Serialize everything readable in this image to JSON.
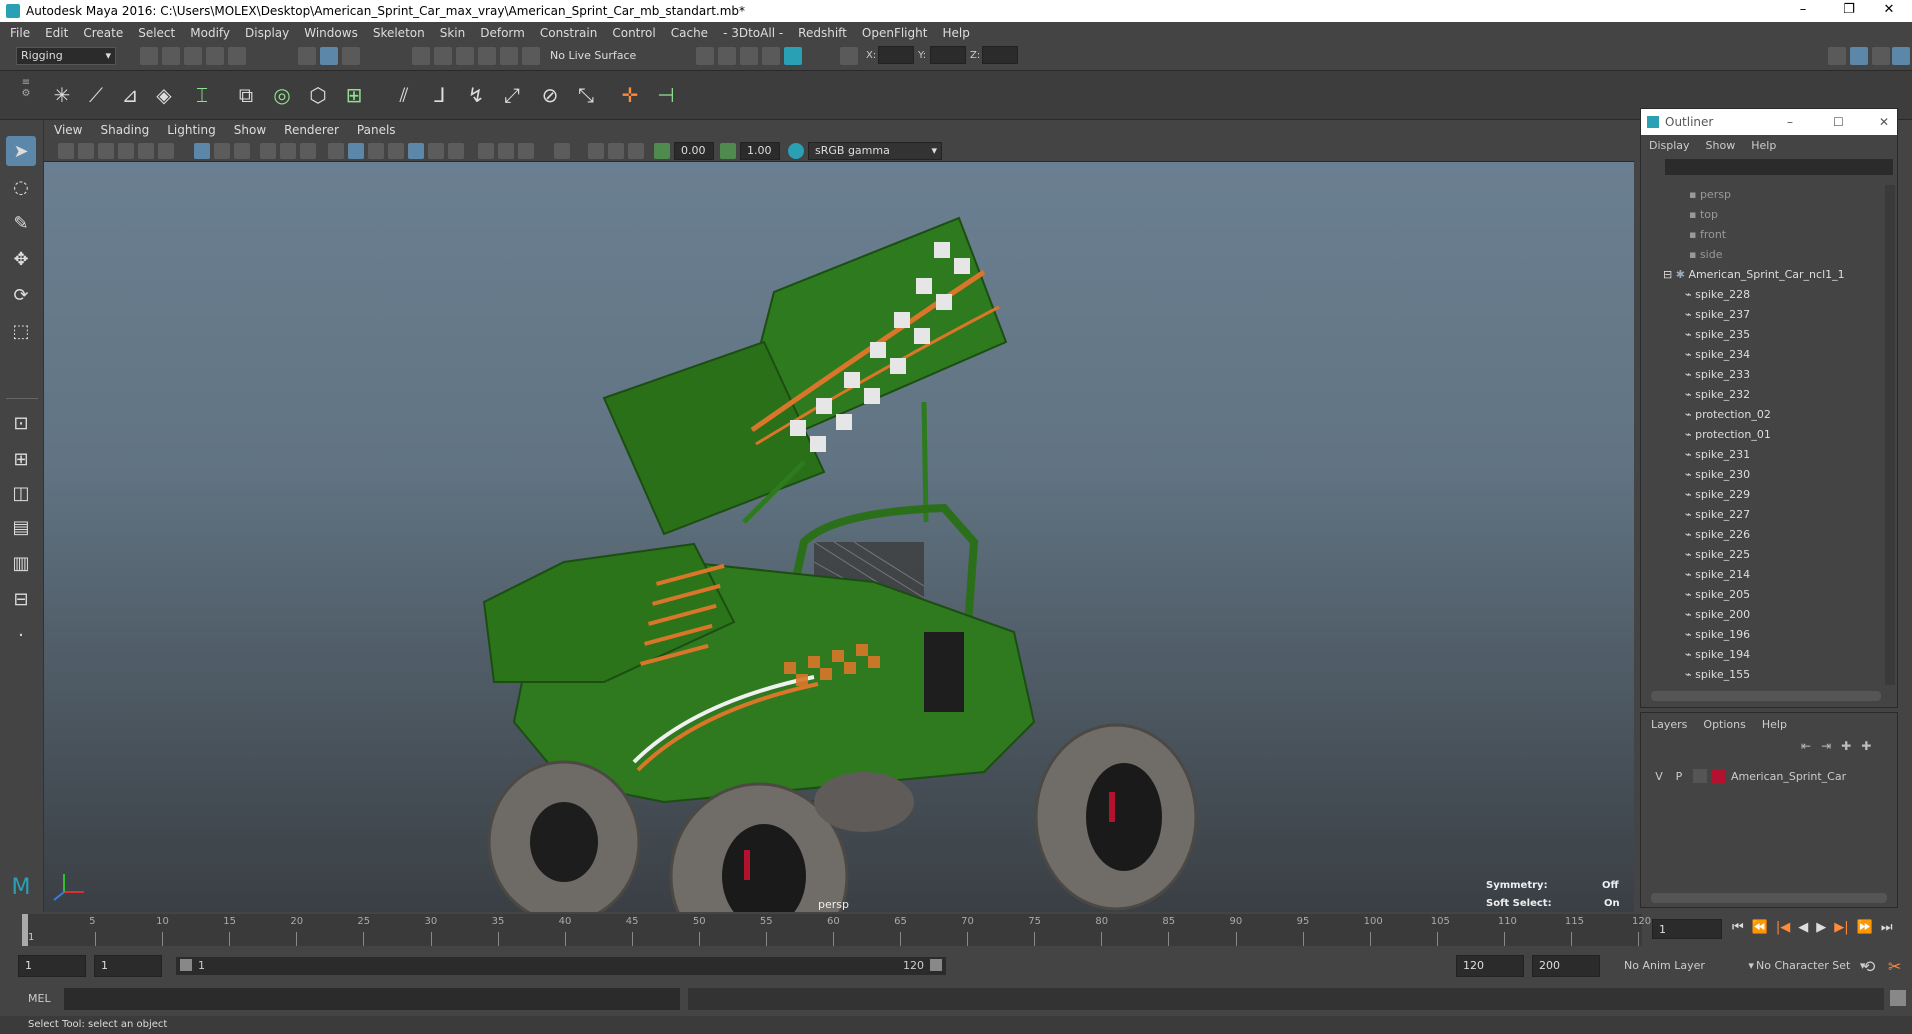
{
  "window": {
    "title": "Autodesk Maya 2016: C:\\Users\\MOLEX\\Desktop\\American_Sprint_Car_max_vray\\American_Sprint_Car_mb_standart.mb*",
    "minimize": "–",
    "restore": "❐",
    "close": "✕"
  },
  "menubar": [
    "File",
    "Edit",
    "Create",
    "Select",
    "Modify",
    "Display",
    "Windows",
    "Skeleton",
    "Skin",
    "Deform",
    "Constrain",
    "Control",
    "Cache",
    "- 3DtoAll -",
    "Redshift",
    "OpenFlight",
    "Help"
  ],
  "statusline": {
    "menuset": "Rigging",
    "live_surface": "No Live Surface",
    "x_label": "X:",
    "y_label": "Y:",
    "z_label": "Z:"
  },
  "viewport": {
    "menus": [
      "View",
      "Shading",
      "Lighting",
      "Show",
      "Renderer",
      "Panels"
    ],
    "near_value": "0.00",
    "far_value": "1.00",
    "color_space": "sRGB gamma",
    "camera_label": "persp",
    "symmetry_label": "Symmetry:",
    "symmetry_value": "Off",
    "soft_select_label": "Soft Select:",
    "soft_select_value": "On"
  },
  "outliner": {
    "title": "Outliner",
    "menus": [
      "Display",
      "Show",
      "Help"
    ],
    "cameras": [
      "persp",
      "top",
      "front",
      "side"
    ],
    "group": "American_Sprint_Car_ncl1_1",
    "items": [
      "spike_228",
      "spike_237",
      "spike_235",
      "spike_234",
      "spike_233",
      "spike_232",
      "protection_02",
      "protection_01",
      "spike_231",
      "spike_230",
      "spike_229",
      "spike_227",
      "spike_226",
      "spike_225",
      "spike_214",
      "spike_205",
      "spike_200",
      "spike_196",
      "spike_194",
      "spike_155"
    ]
  },
  "layers": {
    "menus": [
      "Layers",
      "Options",
      "Help"
    ],
    "layer_v": "V",
    "layer_p": "P",
    "layer_name": "American_Sprint_Car",
    "layer_color": "#b3122e"
  },
  "timeline": {
    "ticks": [
      "5",
      "10",
      "15",
      "20",
      "25",
      "30",
      "35",
      "40",
      "45",
      "50",
      "55",
      "60",
      "65",
      "70",
      "75",
      "80",
      "85",
      "90",
      "95",
      "100",
      "105",
      "110",
      "115",
      "120"
    ],
    "start_marker": "1",
    "current_frame": "1"
  },
  "range": {
    "start": "1",
    "playback_start": "1",
    "slider_left": "1",
    "slider_right": "120",
    "playback_end": "120",
    "end": "200",
    "anim_layer": "No Anim Layer",
    "character_set": "No Character Set"
  },
  "cmdline": {
    "label": "MEL"
  },
  "helpline": {
    "text": "Select Tool: select an object"
  },
  "colors": {
    "car_green": "#2f7a1f",
    "stripe_orange": "#d9762a",
    "tire": "#6e6a66",
    "accent_teal": "#2aa0b5"
  }
}
